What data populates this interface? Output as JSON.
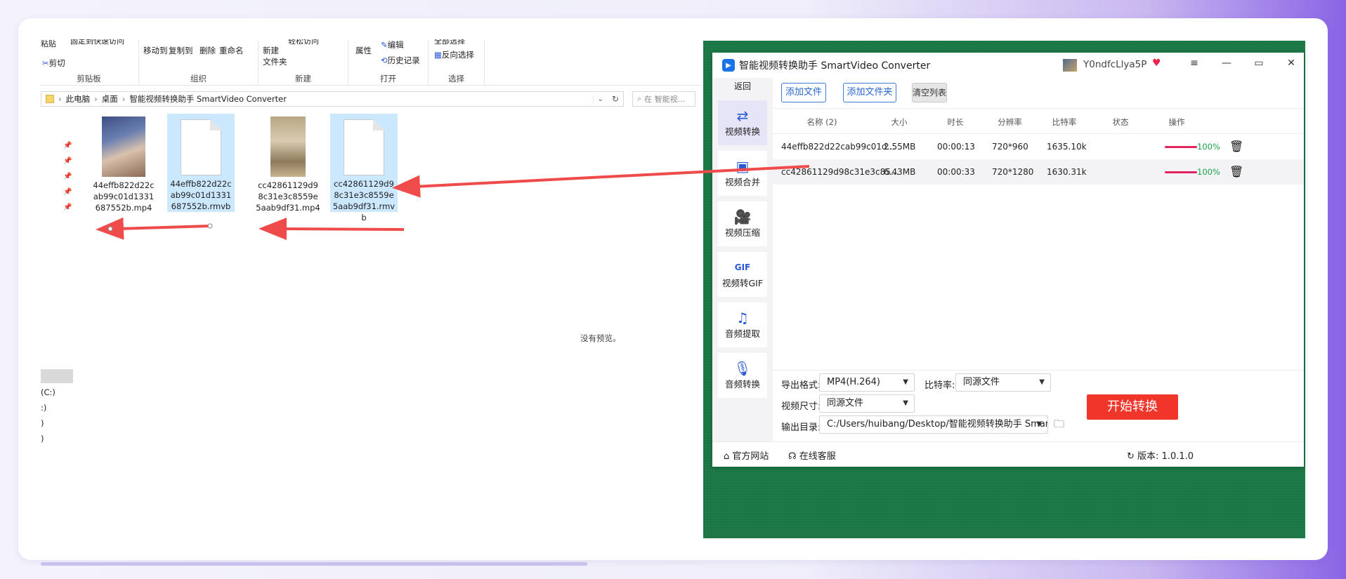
{
  "explorer": {
    "ribbon": {
      "clipboard": {
        "paste": "粘贴",
        "pin_quick_access": "固定到快速访问",
        "cut": "剪切",
        "title": "剪贴板"
      },
      "organize": {
        "move_to": "移动到",
        "copy_to": "复制到",
        "delete": "删除",
        "rename": "重命名",
        "title": "组织"
      },
      "new": {
        "new_folder_line1": "新建",
        "new_folder_line2": "文件夹",
        "easy_access": "轻松访问",
        "title": "新建"
      },
      "open": {
        "properties": "属性",
        "edit": "编辑",
        "history": "历史记录",
        "title": "打开"
      },
      "select": {
        "select_all": "全部选择",
        "invert": "反向选择",
        "title": "选择"
      }
    },
    "address": {
      "crumbs": [
        "此电脑",
        "桌面",
        "智能视频转换助手 SmartVideo Converter"
      ],
      "search_placeholder": "在 智能视..."
    },
    "files": [
      {
        "name": "44effb822d22cab99c01d1331687552b.mp4",
        "type": "video",
        "selected": false
      },
      {
        "name": "44effb822d22cab99c01d1331687552b.rmvb",
        "type": "doc",
        "selected": true
      },
      {
        "name": "cc42861129d98c31e3c8559e5aab9df31.mp4",
        "type": "video",
        "selected": false
      },
      {
        "name": "cc42861129d98c31e3c8559e5aab9df31.rmvb",
        "type": "doc",
        "selected": true
      }
    ],
    "no_preview": "没有预览。",
    "drive_lines": [
      "(C:)",
      ":)",
      ")",
      ")"
    ]
  },
  "converter": {
    "title": "智能视频转换助手 SmartVideo Converter",
    "user": "Y0ndfcLlya5P",
    "sidebar": {
      "back": "返回",
      "items": [
        {
          "label": "视频转换",
          "icon": "video-convert-icon",
          "active": true
        },
        {
          "label": "视频合并",
          "icon": "video-merge-icon",
          "active": false
        },
        {
          "label": "视频压缩",
          "icon": "video-compress-icon",
          "active": false
        },
        {
          "label": "视频转GIF",
          "icon": "gif-icon",
          "active": false
        },
        {
          "label": "音频提取",
          "icon": "music-icon",
          "active": false
        },
        {
          "label": "音频转换",
          "icon": "microphone-icon",
          "active": false
        }
      ]
    },
    "toolbar": {
      "add_file": "添加文件",
      "add_folder": "添加文件夹",
      "clear": "清空列表"
    },
    "table": {
      "headers": [
        "名称 (2)",
        "大小",
        "时长",
        "分辨率",
        "比特率",
        "状态",
        "操作"
      ],
      "rows": [
        {
          "name": "44effb822d22cab99c01d...",
          "size": "2.55MB",
          "duration": "00:00:13",
          "resolution": "720*960",
          "bitrate": "1635.10k",
          "progress": "100%"
        },
        {
          "name": "cc42861129d98c31e3c85...",
          "size": "6.43MB",
          "duration": "00:00:33",
          "resolution": "720*1280",
          "bitrate": "1630.31k",
          "progress": "100%"
        }
      ]
    },
    "settings": {
      "format_label": "导出格式:",
      "format_value": "MP4(H.264)",
      "bitrate_label": "比特率:",
      "bitrate_value": "同源文件",
      "size_label": "视频尺寸:",
      "size_value": "同源文件",
      "output_label": "输出目录:",
      "output_value": "C:/Users/huibang/Desktop/智能视频转换助手 SmartVideo",
      "start": "开始转换"
    },
    "statusbar": {
      "website": "官方网站",
      "support": "在线客服",
      "version_label": "版本:",
      "version": "1.0.1.0"
    },
    "colors": {
      "accent": "#2767d1",
      "start": "#f0352a",
      "progress": "#e0245e",
      "progress_text": "#1aa34a",
      "bg_green": "#1e7a48"
    }
  }
}
